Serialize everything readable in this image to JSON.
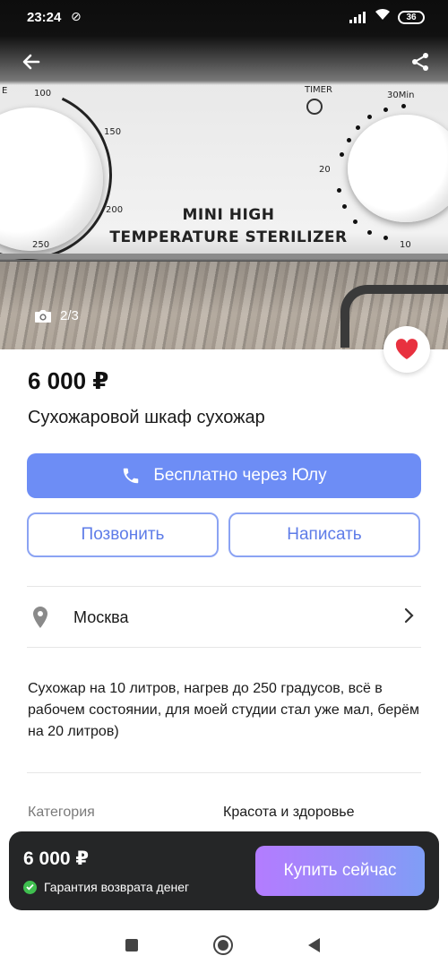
{
  "status_bar": {
    "time": "23:24",
    "battery": "36"
  },
  "photo": {
    "counter": "2/3",
    "product_label_line1": "MINI HIGH",
    "product_label_line2": "TEMPERATURE STERILIZER",
    "dial_left_ticks": [
      "100",
      "150",
      "200",
      "250",
      "E"
    ],
    "timer_label": "TIMER",
    "timer_ticks": [
      "30Min",
      "20",
      "10"
    ]
  },
  "listing": {
    "price": "6 000 ₽",
    "title": "Сухожаровой шкаф сухожар",
    "favorite": true
  },
  "actions": {
    "primary_label": "Бесплатно через Юлу",
    "call_label": "Позвонить",
    "message_label": "Написать"
  },
  "location": {
    "city": "Москва"
  },
  "description": "Сухожар на 10 литров, нагрев до 250 градусов, всё в рабочем состоянии, для моей студии стал уже мал, берём на 20 литров)",
  "details": {
    "category_label": "Категория",
    "category_value": "Красота и здоровье"
  },
  "buy_bar": {
    "price": "6 000 ₽",
    "guarantee": "Гарантия возврата денег",
    "buy_label": "Купить сейчас"
  },
  "colors": {
    "primary": "#6d8df5",
    "heart": "#e8313f",
    "buy_gradient_start": "#b37cff",
    "buy_gradient_end": "#7f9ef6",
    "check": "#3fbf4f"
  },
  "icons": [
    "back-arrow-icon",
    "share-icon",
    "camera-icon",
    "heart-icon",
    "phone-icon",
    "location-pin-icon",
    "chevron-right-icon",
    "check-icon"
  ]
}
